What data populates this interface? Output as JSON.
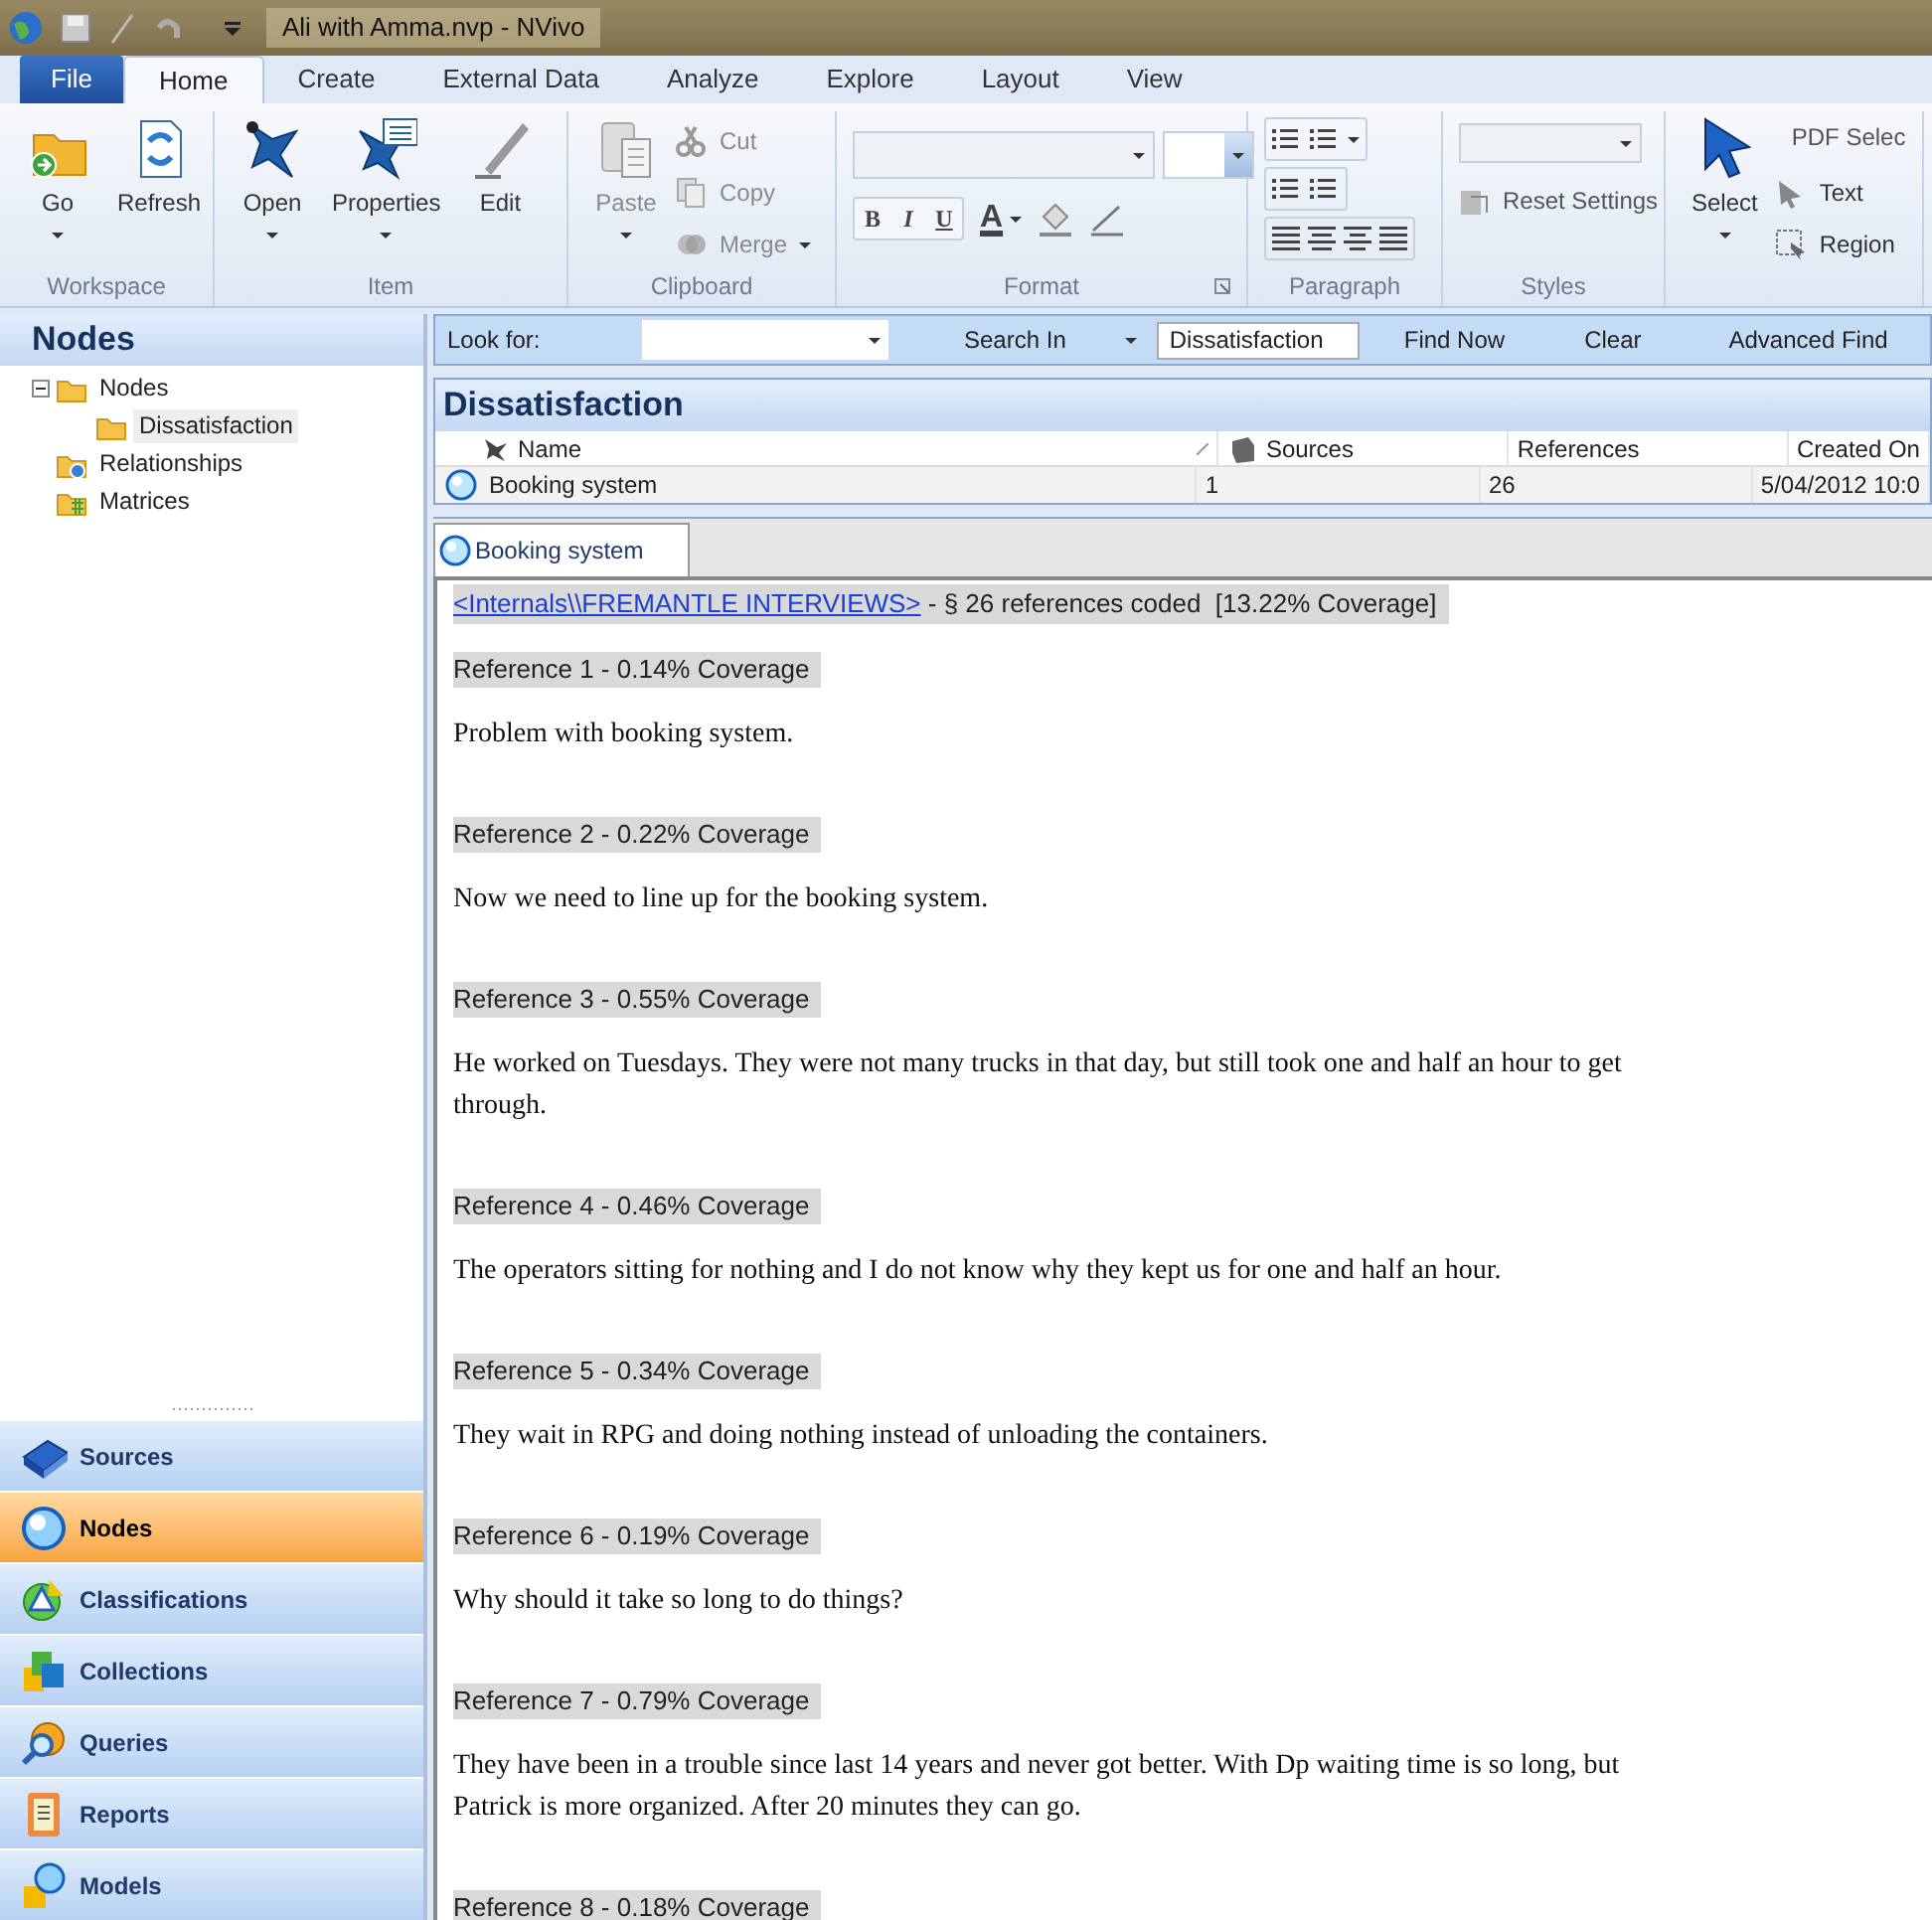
{
  "window": {
    "title": "Ali with Amma.nvp - NVivo"
  },
  "ribbon_tabs": [
    {
      "label": "File",
      "kind": "file",
      "selected": false
    },
    {
      "label": "Home",
      "kind": "tab",
      "selected": true
    },
    {
      "label": "Create",
      "kind": "tab",
      "selected": false
    },
    {
      "label": "External Data",
      "kind": "tab",
      "selected": false
    },
    {
      "label": "Analyze",
      "kind": "tab",
      "selected": false
    },
    {
      "label": "Explore",
      "kind": "tab",
      "selected": false
    },
    {
      "label": "Layout",
      "kind": "tab",
      "selected": false
    },
    {
      "label": "View",
      "kind": "tab",
      "selected": false
    }
  ],
  "ribbon_groups": [
    {
      "label": "Workspace",
      "items": [
        {
          "kind": "large",
          "label": "Go",
          "dropdown": true,
          "disabled": false
        },
        {
          "kind": "large",
          "label": "Refresh",
          "dropdown": false,
          "disabled": false
        }
      ]
    },
    {
      "label": "Item",
      "items": [
        {
          "kind": "large",
          "label": "Open",
          "dropdown": true,
          "disabled": false
        },
        {
          "kind": "large",
          "label": "Properties",
          "dropdown": true,
          "disabled": false
        },
        {
          "kind": "large",
          "label": "Edit",
          "dropdown": false,
          "disabled": false
        }
      ]
    },
    {
      "label": "Clipboard",
      "items": [
        {
          "kind": "large",
          "label": "Paste",
          "dropdown": true,
          "disabled": true
        },
        {
          "kind": "column",
          "items": [
            {
              "kind": "button",
              "label": "Cut",
              "dropdown": false,
              "disabled": true
            },
            {
              "kind": "button",
              "label": "Copy",
              "dropdown": false,
              "disabled": true
            },
            {
              "kind": "button",
              "label": "Merge",
              "dropdown": true,
              "disabled": true
            }
          ]
        }
      ]
    },
    {
      "label": "Format",
      "items": [
        {
          "kind": "format",
          "buttons": [
            "B",
            "I",
            "U"
          ],
          "font_color": "A"
        }
      ]
    },
    {
      "label": "Paragraph",
      "items": [
        {
          "kind": "paragraph"
        }
      ]
    },
    {
      "label": "Styles",
      "items": [
        {
          "kind": "styles",
          "label": "Reset Settings"
        }
      ]
    },
    {
      "items": [
        {
          "kind": "large",
          "label": "Select",
          "dropdown": true,
          "disabled": false
        },
        {
          "kind": "column",
          "items": [
            {
              "kind": "label",
              "label": "PDF Selec"
            },
            {
              "kind": "button",
              "label": "Text",
              "dropdown": false,
              "disabled": false
            },
            {
              "kind": "button",
              "label": "Region",
              "dropdown": false,
              "disabled": false
            }
          ]
        }
      ]
    }
  ],
  "navigation": {
    "title": "Nodes",
    "tree": [
      {
        "label": "Nodes",
        "expanded": true,
        "selected": false,
        "children": [
          {
            "label": "Dissatisfaction",
            "selected": true
          }
        ]
      },
      {
        "label": "Relationships",
        "selected": false
      },
      {
        "label": "Matrices",
        "selected": false
      }
    ],
    "buttons": [
      {
        "label": "Sources",
        "selected": false
      },
      {
        "label": "Nodes",
        "selected": true
      },
      {
        "label": "Classifications",
        "selected": false
      },
      {
        "label": "Collections",
        "selected": false
      },
      {
        "label": "Queries",
        "selected": false
      },
      {
        "label": "Reports",
        "selected": false
      },
      {
        "label": "Models",
        "selected": false
      }
    ]
  },
  "find_bar": {
    "look_for_label": "Look for:",
    "search_in": "Search In",
    "search_in_value": "Dissatisfaction",
    "buttons": [
      "Find Now",
      "Clear",
      "Advanced Find"
    ]
  },
  "list_view": {
    "title": "Dissatisfaction",
    "columns": [
      "Name",
      "Sources",
      "References",
      "Created On"
    ],
    "rows": [
      {
        "cells": [
          "Booking system",
          "1",
          "26",
          "5/04/2012 10:0"
        ]
      }
    ]
  },
  "document_tabs": [
    {
      "label": "Booking system",
      "selected": true
    }
  ],
  "document": {
    "source_link": "<Internals\\\\FREMANTLE INTERVIEWS>",
    "source_summary": " - § 26 references coded  [13.22% Coverage]",
    "references": [
      {
        "heading": "Reference 1 - 0.14% Coverage",
        "text": "Problem with booking system."
      },
      {
        "heading": "Reference 2 - 0.22% Coverage",
        "text": "Now we need to line up for the booking system."
      },
      {
        "heading": "Reference 3 - 0.55% Coverage",
        "text": "He worked on Tuesdays. They were not many trucks in that day, but still took one and half an hour to get through."
      },
      {
        "heading": "Reference 4 - 0.46% Coverage",
        "text": "The operators sitting for nothing and I do not know why they kept us for one and half an hour."
      },
      {
        "heading": "Reference 5 - 0.34% Coverage",
        "text": "They wait in RPG and doing nothing instead of unloading the containers."
      },
      {
        "heading": "Reference 6 - 0.19% Coverage",
        "text": "Why should it take so long to do things?"
      },
      {
        "heading": "Reference 7 - 0.79% Coverage",
        "text": "They have been in a trouble since last 14 years and never got better. With Dp waiting time is so long, but Patrick is more organized. After 20 minutes they can go."
      },
      {
        "heading": "Reference 8 - 0.18% Coverage"
      }
    ]
  }
}
